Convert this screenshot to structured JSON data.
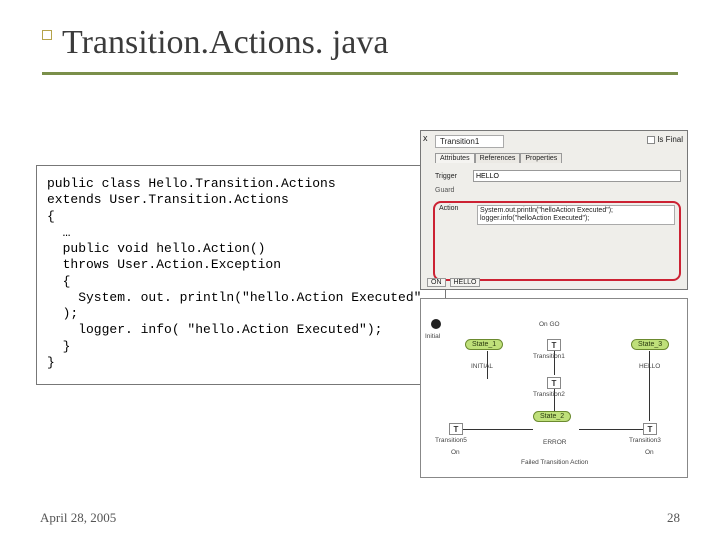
{
  "slide": {
    "title": "Transition.Actions. java",
    "date": "April 28, 2005",
    "page": "28"
  },
  "code": "public class Hello.Transition.Actions\nextends User.Transition.Actions\n{\n  …\n  public void hello.Action()\n  throws User.Action.Exception\n  {\n    System. out. println(\"hello.Action Executed\"\n  );\n    logger. info( \"hello.Action Executed\");\n  }\n}",
  "panel": {
    "close": "x",
    "name": "Transition1",
    "isfinal": "Is Final",
    "tabs": {
      "a": "Attributes",
      "b": "References",
      "c": "Properties"
    },
    "trigger_label": "Trigger",
    "trigger_value": "HELLO",
    "guard_label": "Guard",
    "action_label": "Action",
    "action_value": "System.out.println(\"helloAction Executed\");\nlogger.info(\"helloAction Executed\");",
    "btn_on": "ON",
    "btn_hello": "HELLO"
  },
  "diagram": {
    "initial": "Initial",
    "s1": "State_1",
    "s2": "State_2",
    "s3": "State_3",
    "t": "T",
    "initial_lbl": "INITIAL",
    "trans1": "Transition1",
    "trans2": "Transition2",
    "trans3": "Transition3",
    "trans5": "Transition5",
    "hello": "HELLO",
    "error": "ERROR",
    "on_go": "On GO",
    "on": "On",
    "failed": "Failed Transition Action"
  }
}
